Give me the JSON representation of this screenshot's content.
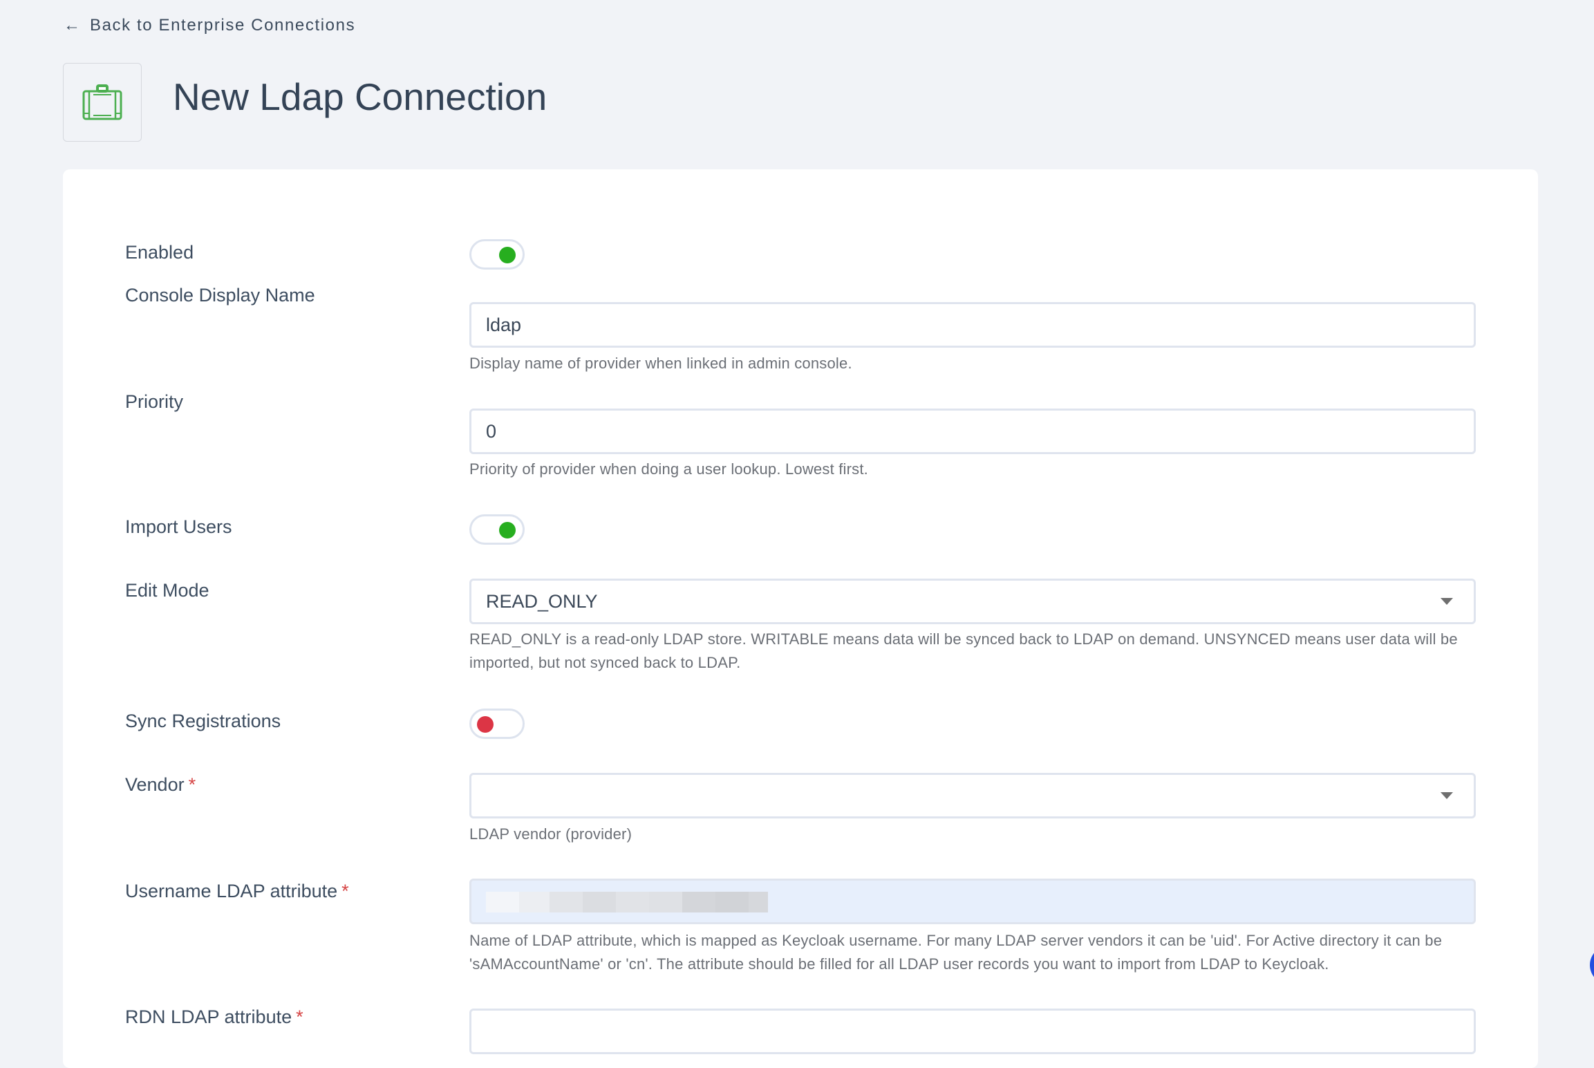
{
  "nav": {
    "back_arrow_icon": "arrow-left-icon",
    "back_label": "Back to Enterprise Connections"
  },
  "header": {
    "icon": "briefcase-icon",
    "title": "New Ldap Connection"
  },
  "colors": {
    "accent_green": "#27ae1f",
    "toggle_off_red": "#dc3545",
    "required_red": "#d64545",
    "icon_green": "#4caf50",
    "autofill_blue": "#e7effc"
  },
  "form": {
    "enabled": {
      "label": "Enabled",
      "value": true
    },
    "console_display_name": {
      "label": "Console Display Name",
      "value": "ldap",
      "help": "Display name of provider when linked in admin console."
    },
    "priority": {
      "label": "Priority",
      "value": "0",
      "help": "Priority of provider when doing a user lookup. Lowest first."
    },
    "import_users": {
      "label": "Import Users",
      "value": true
    },
    "edit_mode": {
      "label": "Edit Mode",
      "value": "READ_ONLY",
      "help": "READ_ONLY is a read-only LDAP store. WRITABLE means data will be synced back to LDAP on demand. UNSYNCED means user data will be imported, but not synced back to LDAP."
    },
    "sync_registrations": {
      "label": "Sync Registrations",
      "value": false
    },
    "vendor": {
      "label": "Vendor",
      "required_mark": "*",
      "value": "",
      "help": "LDAP vendor (provider)"
    },
    "username_ldap_attribute": {
      "label": "Username LDAP attribute",
      "required_mark": "*",
      "value_redacted": true,
      "help": "Name of LDAP attribute, which is mapped as Keycloak username. For many LDAP server vendors it can be 'uid'. For Active directory it can be 'sAMAccountName' or 'cn'. The attribute should be filled for all LDAP user records you want to import from LDAP to Keycloak."
    },
    "rdn_ldap_attribute": {
      "label": "RDN LDAP attribute",
      "required_mark": "*"
    }
  }
}
